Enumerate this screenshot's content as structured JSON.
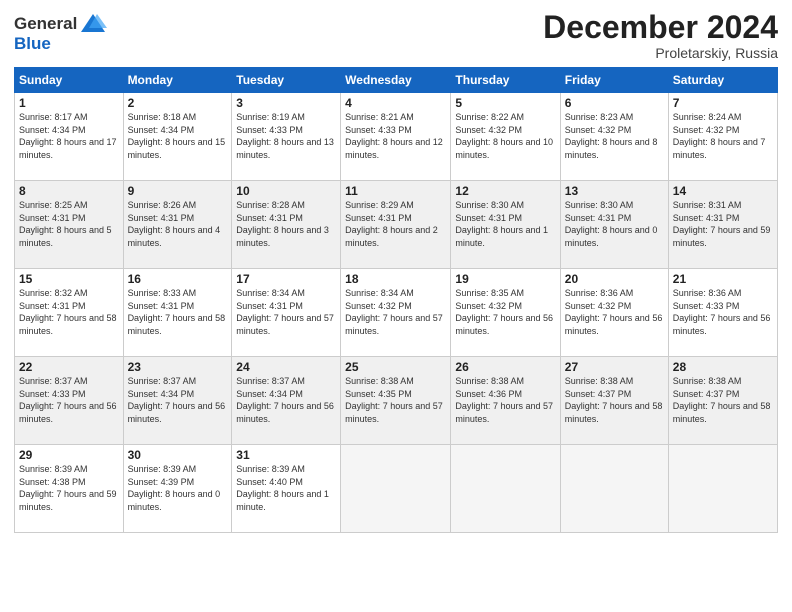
{
  "header": {
    "logo_general": "General",
    "logo_blue": "Blue",
    "month_title": "December 2024",
    "location": "Proletarskiy, Russia"
  },
  "weekdays": [
    "Sunday",
    "Monday",
    "Tuesday",
    "Wednesday",
    "Thursday",
    "Friday",
    "Saturday"
  ],
  "weeks": [
    [
      {
        "day": "1",
        "sunrise": "8:17 AM",
        "sunset": "4:34 PM",
        "daylight": "8 hours and 17 minutes."
      },
      {
        "day": "2",
        "sunrise": "8:18 AM",
        "sunset": "4:34 PM",
        "daylight": "8 hours and 15 minutes."
      },
      {
        "day": "3",
        "sunrise": "8:19 AM",
        "sunset": "4:33 PM",
        "daylight": "8 hours and 13 minutes."
      },
      {
        "day": "4",
        "sunrise": "8:21 AM",
        "sunset": "4:33 PM",
        "daylight": "8 hours and 12 minutes."
      },
      {
        "day": "5",
        "sunrise": "8:22 AM",
        "sunset": "4:32 PM",
        "daylight": "8 hours and 10 minutes."
      },
      {
        "day": "6",
        "sunrise": "8:23 AM",
        "sunset": "4:32 PM",
        "daylight": "8 hours and 8 minutes."
      },
      {
        "day": "7",
        "sunrise": "8:24 AM",
        "sunset": "4:32 PM",
        "daylight": "8 hours and 7 minutes."
      }
    ],
    [
      {
        "day": "8",
        "sunrise": "8:25 AM",
        "sunset": "4:31 PM",
        "daylight": "8 hours and 5 minutes."
      },
      {
        "day": "9",
        "sunrise": "8:26 AM",
        "sunset": "4:31 PM",
        "daylight": "8 hours and 4 minutes."
      },
      {
        "day": "10",
        "sunrise": "8:28 AM",
        "sunset": "4:31 PM",
        "daylight": "8 hours and 3 minutes."
      },
      {
        "day": "11",
        "sunrise": "8:29 AM",
        "sunset": "4:31 PM",
        "daylight": "8 hours and 2 minutes."
      },
      {
        "day": "12",
        "sunrise": "8:30 AM",
        "sunset": "4:31 PM",
        "daylight": "8 hours and 1 minute."
      },
      {
        "day": "13",
        "sunrise": "8:30 AM",
        "sunset": "4:31 PM",
        "daylight": "8 hours and 0 minutes."
      },
      {
        "day": "14",
        "sunrise": "8:31 AM",
        "sunset": "4:31 PM",
        "daylight": "7 hours and 59 minutes."
      }
    ],
    [
      {
        "day": "15",
        "sunrise": "8:32 AM",
        "sunset": "4:31 PM",
        "daylight": "7 hours and 58 minutes."
      },
      {
        "day": "16",
        "sunrise": "8:33 AM",
        "sunset": "4:31 PM",
        "daylight": "7 hours and 58 minutes."
      },
      {
        "day": "17",
        "sunrise": "8:34 AM",
        "sunset": "4:31 PM",
        "daylight": "7 hours and 57 minutes."
      },
      {
        "day": "18",
        "sunrise": "8:34 AM",
        "sunset": "4:32 PM",
        "daylight": "7 hours and 57 minutes."
      },
      {
        "day": "19",
        "sunrise": "8:35 AM",
        "sunset": "4:32 PM",
        "daylight": "7 hours and 56 minutes."
      },
      {
        "day": "20",
        "sunrise": "8:36 AM",
        "sunset": "4:32 PM",
        "daylight": "7 hours and 56 minutes."
      },
      {
        "day": "21",
        "sunrise": "8:36 AM",
        "sunset": "4:33 PM",
        "daylight": "7 hours and 56 minutes."
      }
    ],
    [
      {
        "day": "22",
        "sunrise": "8:37 AM",
        "sunset": "4:33 PM",
        "daylight": "7 hours and 56 minutes."
      },
      {
        "day": "23",
        "sunrise": "8:37 AM",
        "sunset": "4:34 PM",
        "daylight": "7 hours and 56 minutes."
      },
      {
        "day": "24",
        "sunrise": "8:37 AM",
        "sunset": "4:34 PM",
        "daylight": "7 hours and 56 minutes."
      },
      {
        "day": "25",
        "sunrise": "8:38 AM",
        "sunset": "4:35 PM",
        "daylight": "7 hours and 57 minutes."
      },
      {
        "day": "26",
        "sunrise": "8:38 AM",
        "sunset": "4:36 PM",
        "daylight": "7 hours and 57 minutes."
      },
      {
        "day": "27",
        "sunrise": "8:38 AM",
        "sunset": "4:37 PM",
        "daylight": "7 hours and 58 minutes."
      },
      {
        "day": "28",
        "sunrise": "8:38 AM",
        "sunset": "4:37 PM",
        "daylight": "7 hours and 58 minutes."
      }
    ],
    [
      {
        "day": "29",
        "sunrise": "8:39 AM",
        "sunset": "4:38 PM",
        "daylight": "7 hours and 59 minutes."
      },
      {
        "day": "30",
        "sunrise": "8:39 AM",
        "sunset": "4:39 PM",
        "daylight": "8 hours and 0 minutes."
      },
      {
        "day": "31",
        "sunrise": "8:39 AM",
        "sunset": "4:40 PM",
        "daylight": "8 hours and 1 minute."
      },
      null,
      null,
      null,
      null
    ]
  ]
}
